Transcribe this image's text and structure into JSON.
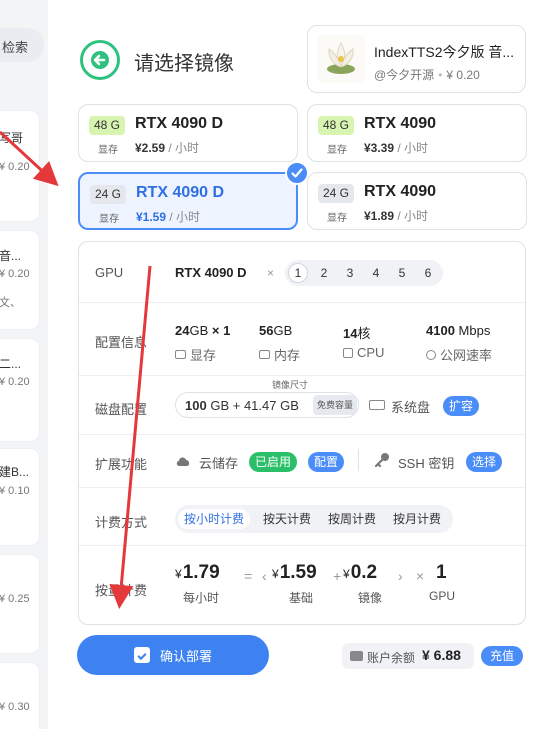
{
  "sidebar": {
    "search_label": "检索",
    "items": [
      {
        "title": "写哥",
        "price": "¥ 0.20",
        "extra": ""
      },
      {
        "title": "音...",
        "price": "¥ 0.20",
        "extra": "文、"
      },
      {
        "title": "二...",
        "price": "¥ 0.20",
        "extra": ""
      },
      {
        "title": "建B...",
        "price": "¥ 0.10",
        "extra": ""
      },
      {
        "title": "",
        "price": "¥ 0.25",
        "extra": ""
      },
      {
        "title": "",
        "price": "¥ 0.30",
        "extra": ""
      }
    ]
  },
  "header": {
    "title": "请选择镜像",
    "mirror": {
      "name": "IndexTTS2今夕版 音...",
      "author": "@今夕开源",
      "price": "¥ 0.20"
    }
  },
  "gpu_options": [
    {
      "vram": "48 G",
      "vram_label": "显存",
      "name": "RTX 4090 D",
      "price": "¥2.59",
      "unit": " / 小时",
      "selected": false
    },
    {
      "vram": "48 G",
      "vram_label": "显存",
      "name": "RTX 4090",
      "price": "¥3.39",
      "unit": " / 小时",
      "selected": false
    },
    {
      "vram": "24 G",
      "vram_label": "显存",
      "name": "RTX 4090 D",
      "price": "¥1.59",
      "unit": " / 小时",
      "selected": true
    },
    {
      "vram": "24 G",
      "vram_label": "显存",
      "name": "RTX 4090",
      "price": "¥1.89",
      "unit": " / 小时",
      "selected": false
    }
  ],
  "config": {
    "gpu": {
      "label": "GPU",
      "selected": "RTX 4090 D",
      "times": "×",
      "counts": [
        "1",
        "2",
        "3",
        "4",
        "5",
        "6"
      ],
      "selected_count": "1"
    },
    "specs": {
      "label": "配置信息",
      "vram_value": "24",
      "vram_unit": "GB",
      "vram_mult": "× 1",
      "vram_label": "显存",
      "ram_value": "56",
      "ram_unit": "GB",
      "ram_label": "内存",
      "cpu_value": "14",
      "cpu_unit": "核",
      "cpu_label": "CPU",
      "net_value": "4100",
      "net_unit": "Mbps",
      "net_label": "公网速率"
    },
    "disk": {
      "label": "磁盘配置",
      "mirror_size_label": "镜像尺寸",
      "base": "100",
      "base_unit": "GB",
      "extra": "+ 41.47 GB",
      "free_tag": "免费容量",
      "sys_label": "系统盘",
      "expand_label": "扩容"
    },
    "extension": {
      "label": "扩展功能",
      "cloud_label": "云储存",
      "cloud_status": "已启用",
      "cloud_config": "配置",
      "ssh_label": "SSH 密钥",
      "ssh_select": "选择"
    },
    "billing": {
      "label": "计费方式",
      "options": [
        "按小时计费",
        "按天计费",
        "按周计费",
        "按月计费"
      ],
      "active": "按小时计费"
    },
    "calc": {
      "label": "按量计费",
      "currency": "¥",
      "total": "1.79",
      "total_label": "每小时",
      "eq": "=",
      "lt": "‹",
      "base": "1.59",
      "base_label": "基础",
      "plus": "+",
      "mirror": "0.2",
      "mirror_label": "镜像",
      "gt": "›",
      "mult": "×",
      "gpu_count": "1",
      "gpu_label": "GPU"
    }
  },
  "footer": {
    "deploy_label": "确认部署",
    "balance_label": "账户余额",
    "balance_value": "¥ 6.88",
    "recharge_label": "充值"
  },
  "colors": {
    "accent": "#4a8df8",
    "green": "#2bbf6a",
    "annotation_red": "#e5383b"
  }
}
